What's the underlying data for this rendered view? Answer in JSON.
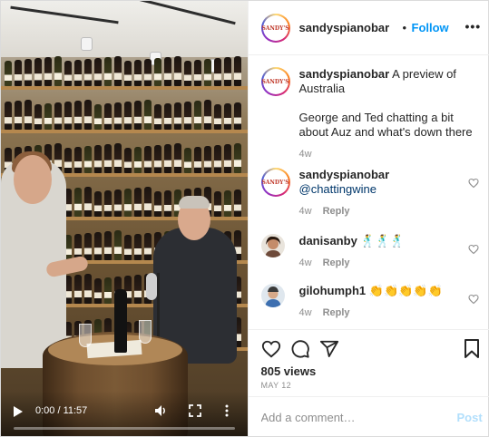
{
  "video": {
    "time": "0:00 / 11:57",
    "progress": 0.0
  },
  "header": {
    "avatar_text": "SANDY'S",
    "username": "sandyspianobar",
    "separator": "•",
    "follow_label": "Follow",
    "more_label": "•••"
  },
  "caption": {
    "username": "sandyspianobar",
    "text_line1": "A preview of Australia",
    "text_line2": "George and Ted chatting a bit about Auz and what's down there",
    "age": "4w"
  },
  "comments": [
    {
      "username": "sandyspianobar",
      "text": "@chattingwine",
      "age": "4w",
      "reply_label": "Reply"
    },
    {
      "username": "danisanby",
      "text": "🕺🕺🕺",
      "age": "4w",
      "reply_label": "Reply"
    },
    {
      "username": "gilohumph1",
      "text": "👏👏👏👏👏",
      "age": "4w",
      "reply_label": "Reply"
    }
  ],
  "stats": {
    "views": "805 views",
    "date": "MAY 12"
  },
  "composer": {
    "placeholder": "Add a comment…",
    "post_label": "Post"
  },
  "colors": {
    "accent": "#0095f6",
    "muted": "#8e8e8e",
    "post_disabled": "#b2dffc"
  }
}
